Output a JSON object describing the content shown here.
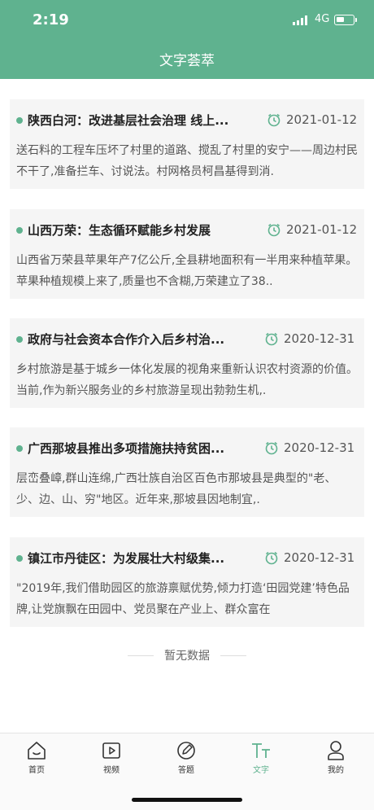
{
  "status_bar": {
    "time": "2:19",
    "network": "4G"
  },
  "header": {
    "title": "文字荟萃"
  },
  "articles": [
    {
      "title": "陕西白河：改进基层社会治理 线上线下共同发力",
      "display_title": "陕西白河：改进基层社会治理 线上...",
      "date": "2021-01-12",
      "summary": "送石料的工程车压坏了村里的道路、搅乱了村里的安宁——周边村民不干了,准备拦车、讨说法。村网格员柯昌基得到消."
    },
    {
      "title": "山西万荣：生态循环赋能乡村发展",
      "display_title": "山西万荣：生态循环赋能乡村发展",
      "date": "2021-01-12",
      "summary": "山西省万荣县苹果年产7亿公斤,全县耕地面积有一半用来种植苹果。苹果种植规模上来了,质量也不含糊,万荣建立了38.."
    },
    {
      "title": "政府与社会资本合作介入后乡村治理",
      "display_title": "政府与社会资本合作介入后乡村治...",
      "date": "2020-12-31",
      "summary": "乡村旅游是基于城乡一体化发展的视角来重新认识农村资源的价值。当前,作为新兴服务业的乡村旅游呈现出勃勃生机,."
    },
    {
      "title": "广西那坡县推出多项措施扶持贫困户",
      "display_title": "广西那坡县推出多项措施扶持贫困...",
      "date": "2020-12-31",
      "summary": "层峦叠嶂,群山连绵,广西壮族自治区百色市那坡县是典型的\"老、少、边、山、穷\"地区。近年来,那坡县因地制宜,."
    },
    {
      "title": "镇江市丹徒区：为发展壮大村级集体经济",
      "display_title": "镇江市丹徒区：为发展壮大村级集...",
      "date": "2020-12-31",
      "summary": "\"2019年,我们借助园区的旅游禀赋优势,倾力打造‘田园党建’特色品牌,让党旗飘在田园中、党员聚在产业上、群众富在"
    }
  ],
  "empty_text": "暂无数据",
  "tabbar": {
    "home": "首页",
    "video": "视频",
    "quiz": "答题",
    "text": "文字",
    "mine": "我的"
  },
  "colors": {
    "accent": "#5fb28f",
    "card_bg": "#f5f5f5"
  }
}
